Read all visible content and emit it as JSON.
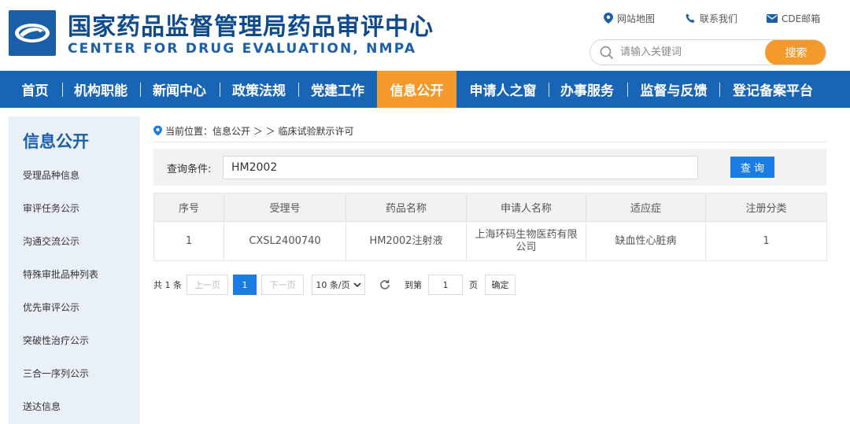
{
  "header": {
    "title_cn": "国家药品监督管理局药品审评中心",
    "title_en": "CENTER FOR DRUG EVALUATION, NMPA",
    "links": {
      "sitemap": "网站地图",
      "contact": "联系我们",
      "mail": "CDE邮箱"
    },
    "search": {
      "placeholder": "请输入关键词",
      "button": "搜索"
    }
  },
  "nav": {
    "items": [
      "首页",
      "机构职能",
      "新闻中心",
      "政策法规",
      "党建工作",
      "信息公开",
      "申请人之窗",
      "办事服务",
      "监督与反馈",
      "登记备案平台"
    ],
    "active": "信息公开"
  },
  "sidebar": {
    "title": "信息公开",
    "items": [
      "受理品种信息",
      "审评任务公示",
      "沟通交流公示",
      "特殊审批品种列表",
      "优先审评公示",
      "突破性治疗公示",
      "三合一序列公示",
      "送达信息"
    ]
  },
  "breadcrumb": "当前位置：信息公开 ＞ ＞ 临床试验默示许可",
  "query": {
    "label": "查询条件:",
    "value": "HM2002",
    "button": "查 询"
  },
  "table": {
    "headers": [
      "序号",
      "受理号",
      "药品名称",
      "申请人名称",
      "适应症",
      "注册分类"
    ],
    "rows": [
      [
        "1",
        "CXSL2400740",
        "HM2002注射液",
        "上海环码生物医药有限公司",
        "缺血性心脏病",
        "1"
      ]
    ]
  },
  "pager": {
    "total": "共 1 条",
    "prev": "上一页",
    "current": "1",
    "next": "下一页",
    "page_size": "10 条/页",
    "goto_label": "到第",
    "goto_value": "1",
    "page_unit": "页",
    "confirm": "确定"
  },
  "colors": {
    "nav_bg": "#1865b6",
    "nav_active": "#f39a2b",
    "brand_blue": "#0e4a8c",
    "button_blue": "#1b7ce3",
    "search_orange": "#f39a2b",
    "sidebar_bg": "#eaf0f8"
  }
}
